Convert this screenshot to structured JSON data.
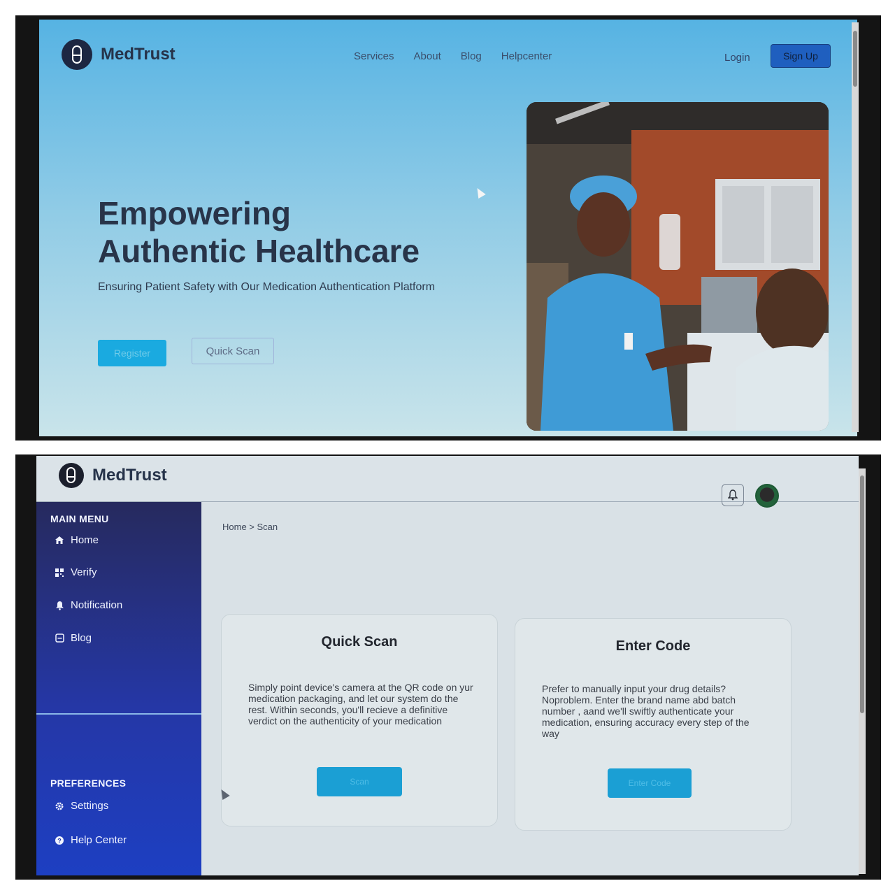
{
  "landing": {
    "brand": "MedTrust",
    "nav": [
      "Services",
      "About",
      "Blog",
      "Helpcenter"
    ],
    "login_label": "Login",
    "signup_label": "Sign Up",
    "hero_title_line1": "Empowering",
    "hero_title_line2": "Authentic Healthcare",
    "hero_subtitle": "Ensuring Patient Safety with Our Medication Authentication Platform",
    "register_label": "Register",
    "quick_scan_label": "Quick Scan"
  },
  "dashboard": {
    "brand": "MedTrust",
    "main_menu_title": "MAIN MENU",
    "menu": [
      {
        "label": "Home",
        "icon": "home-icon"
      },
      {
        "label": "Verify",
        "icon": "qr-icon"
      },
      {
        "label": "Notification",
        "icon": "bell-icon"
      },
      {
        "label": "Blog",
        "icon": "blog-icon"
      }
    ],
    "preferences_title": "PREFERENCES",
    "preferences": [
      {
        "label": "Settings",
        "icon": "gear-icon"
      },
      {
        "label": "Help Center",
        "icon": "help-icon"
      }
    ],
    "breadcrumb": "Home > Scan",
    "quick_scan": {
      "title": "Quick Scan",
      "text": "Simply point device's camera at the QR code on yur medication packaging, and let our system do the rest. Within seconds, you'll recieve a definitive verdict on the authenticity of your medication",
      "button": "Scan"
    },
    "enter_code": {
      "title": "Enter Code",
      "text": "Prefer to manually input your drug details? Noproblem. Enter the brand name abd batch number , aand we'll swiftly authenticate your medication, ensuring accuracy every step of the way",
      "button": "Enter Code"
    }
  },
  "colors": {
    "primary_blue": "#1f5fbf",
    "cta_cyan": "#1aaae0",
    "sidebar_navy": "#262a5e",
    "sidebar_blue": "#1d3fc2",
    "heading_dark": "#283449"
  }
}
